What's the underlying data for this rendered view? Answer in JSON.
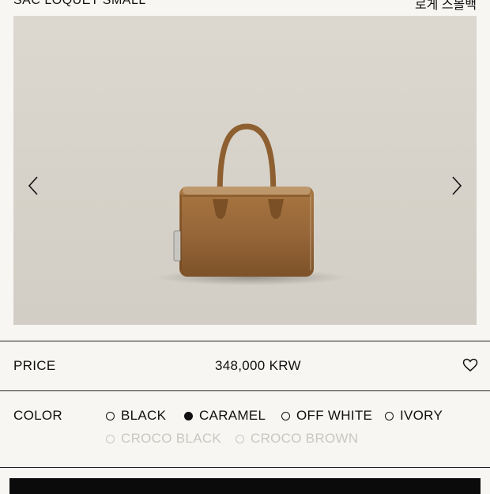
{
  "header": {
    "title": "SAC LOQUET SMALL",
    "title_kr": "로게 스몰백"
  },
  "gallery": {
    "prev_icon": "chevron-left-icon",
    "next_icon": "chevron-right-icon"
  },
  "price": {
    "label": "PRICE",
    "value": "348,000 KRW",
    "wishlist_icon": "heart-icon"
  },
  "color": {
    "label": "COLOR",
    "options": [
      {
        "label": "BLACK",
        "selected": false,
        "available": true
      },
      {
        "label": "CARAMEL",
        "selected": true,
        "available": true
      },
      {
        "label": "OFF WHITE",
        "selected": false,
        "available": true
      },
      {
        "label": "IVORY",
        "selected": false,
        "available": true
      },
      {
        "label": "CROCO BLACK",
        "selected": false,
        "available": false
      },
      {
        "label": "CROCO BROWN",
        "selected": false,
        "available": false
      }
    ]
  },
  "colors": {
    "background": "#f7f6f2",
    "bag": "#9b6a36",
    "disabled_text": "#c9c7c2",
    "cta": "#0b0b0b"
  }
}
